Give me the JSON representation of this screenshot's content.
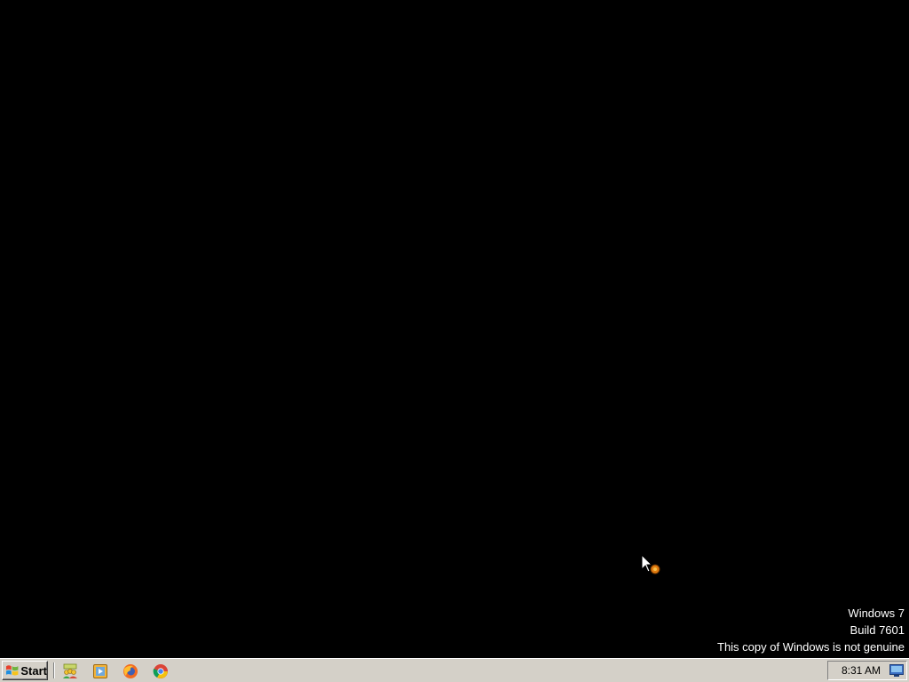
{
  "desktop": {
    "background_color": "#000000",
    "watermark": {
      "os_name": "Windows 7",
      "build": "Build 7601",
      "genuine_notice": "This copy of Windows is not genuine"
    }
  },
  "cursor": {
    "icon": "arrow-busy-cursor-icon"
  },
  "taskbar": {
    "start_label": "Start",
    "quick_launch": [
      {
        "icon": "network-users-icon"
      },
      {
        "icon": "media-player-icon"
      },
      {
        "icon": "firefox-icon"
      },
      {
        "icon": "chrome-icon"
      }
    ],
    "clock": "8:31 AM",
    "tray_icon": "show-desktop-icon"
  }
}
